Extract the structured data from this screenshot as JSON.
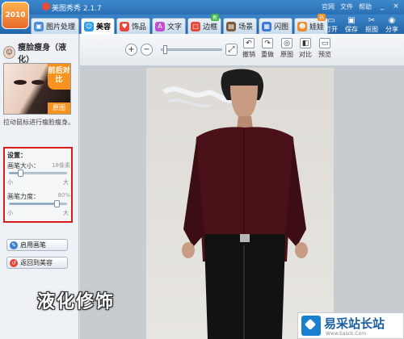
{
  "window": {
    "title": "美图秀秀 2.1.7",
    "top_links": [
      "官网",
      "文件",
      "帮助"
    ],
    "controls": {
      "minimize": "_",
      "maximize": "□",
      "close": "×"
    }
  },
  "app_logo": {
    "text": "2010"
  },
  "tabs": [
    {
      "label": "图片处理",
      "icon": "image-edit-icon",
      "color": "#4a8bd6"
    },
    {
      "label": "美容",
      "icon": "beauty-icon",
      "color": "#2a9be0",
      "active": true
    },
    {
      "label": "饰品",
      "icon": "heart-icon",
      "color": "#e8483b"
    },
    {
      "label": "文字",
      "icon": "text-icon",
      "color": "#c04fd1"
    },
    {
      "label": "边框",
      "icon": "frame-icon",
      "color": "#e24a3a",
      "badge": "新"
    },
    {
      "label": "场景",
      "icon": "scene-icon",
      "color": "#7c5a3b"
    },
    {
      "label": "闪图",
      "icon": "flash-icon",
      "color": "#3a7bd5"
    },
    {
      "label": "娃娃",
      "icon": "doll-icon",
      "color": "#e98b2f",
      "badge": "热"
    }
  ],
  "file_actions": [
    {
      "label": "打开",
      "icon": "open-icon"
    },
    {
      "label": "保存",
      "icon": "save-icon"
    },
    {
      "label": "抠图",
      "icon": "cutout-icon"
    },
    {
      "label": "分享",
      "icon": "share-icon"
    }
  ],
  "left_panel": {
    "title": "瘦脸瘦身（液化）",
    "preview_badge_top": "前后对比",
    "preview_badge_bottom": "原图",
    "hint": "拉动鼠标进行瘦脸瘦身。",
    "settings": {
      "label": "设置：",
      "brush_size": {
        "label": "画笔大小：",
        "value": "18像素",
        "fraction": 0.18,
        "min_label": "小",
        "max_label": "大"
      },
      "brush_strength": {
        "label": "画笔力度：",
        "value": "80%",
        "fraction": 0.8,
        "min_label": "小",
        "max_label": "大"
      }
    },
    "enable_brush": "启用画笔",
    "back_to_beauty": "返回到美容"
  },
  "overlay_caption": "液化修饰",
  "toolbar": {
    "zoom_in": "+",
    "zoom_out": "−",
    "zoom_fraction": 0.02,
    "fit": "⤢",
    "edit_buttons": [
      {
        "label": "撤销",
        "icon": "undo-icon",
        "glyph": "↶"
      },
      {
        "label": "重做",
        "icon": "redo-icon",
        "glyph": "↷"
      },
      {
        "label": "原图",
        "icon": "original-icon",
        "glyph": "◎"
      },
      {
        "label": "对比",
        "icon": "compare-icon",
        "glyph": "◧"
      },
      {
        "label": "预览",
        "icon": "preview-icon",
        "glyph": "▭"
      }
    ]
  },
  "watermark": {
    "text": "易采站长站",
    "url": "Www.Easck.Com"
  }
}
